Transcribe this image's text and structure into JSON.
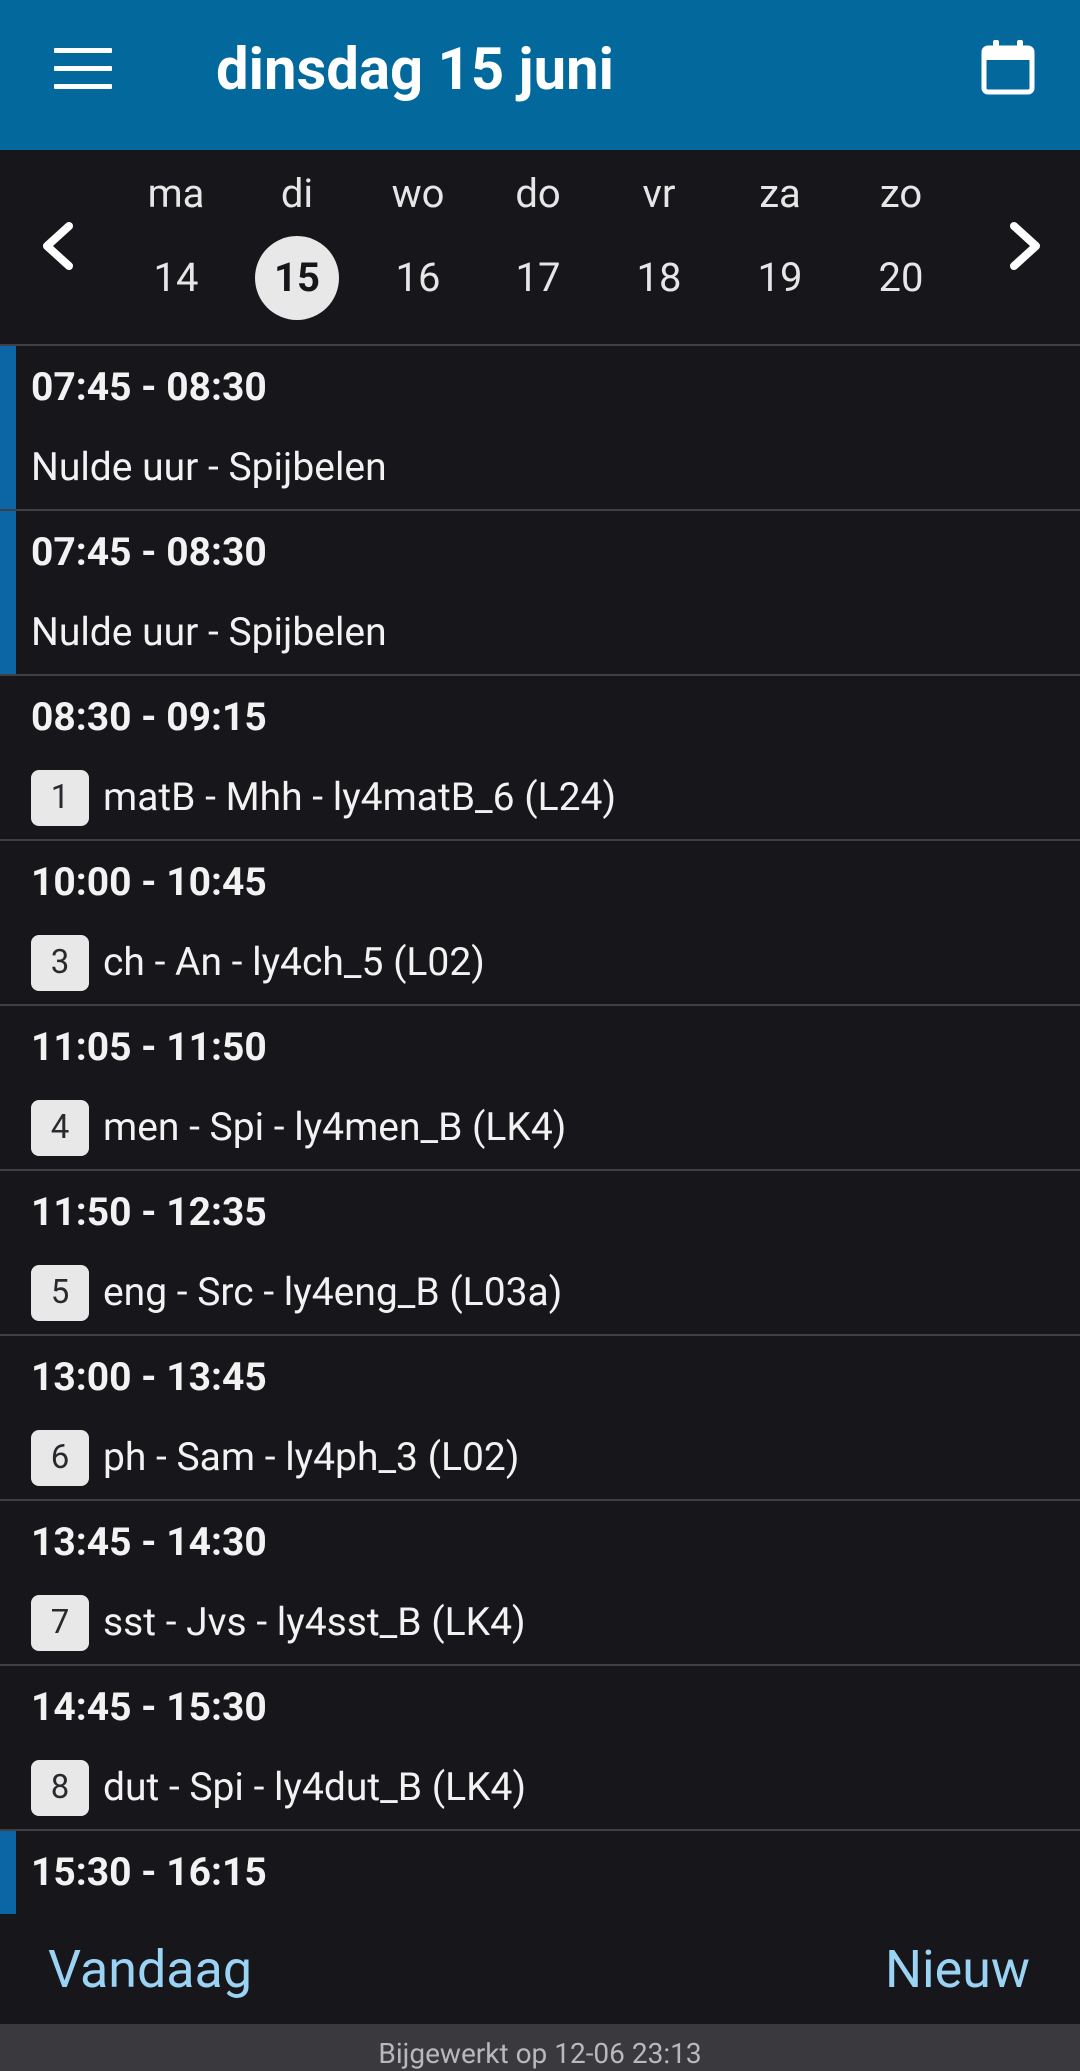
{
  "header": {
    "title": "dinsdag 15 juni",
    "menu_icon": "hamburger-menu-icon",
    "calendar_icon": "calendar-icon",
    "background": "#03689b"
  },
  "week": {
    "prev_icon": "chevron-left-icon",
    "next_icon": "chevron-right-icon",
    "days": [
      {
        "name": "ma",
        "num": "14"
      },
      {
        "name": "di",
        "num": "15"
      },
      {
        "name": "wo",
        "num": "16"
      },
      {
        "name": "do",
        "num": "17"
      },
      {
        "name": "vr",
        "num": "18"
      },
      {
        "name": "za",
        "num": "19"
      },
      {
        "name": "zo",
        "num": "20"
      }
    ],
    "selected": "15"
  },
  "appointments": [
    {
      "time": "07:45 - 08:30",
      "title": "Nulde uur - Spijbelen",
      "hour": "",
      "accent": true
    },
    {
      "time": "07:45 - 08:30",
      "title": "Nulde uur - Spijbelen",
      "hour": "",
      "accent": true
    },
    {
      "time": "08:30 - 09:15",
      "title": "matB - Mhh - ly4matB_6 (L24)",
      "hour": "1",
      "accent": false
    },
    {
      "time": "10:00 - 10:45",
      "title": "ch - An - ly4ch_5 (L02)",
      "hour": "3",
      "accent": false
    },
    {
      "time": "11:05 - 11:50",
      "title": "men - Spi - ly4men_B (LK4)",
      "hour": "4",
      "accent": false
    },
    {
      "time": "11:50 - 12:35",
      "title": "eng - Src - ly4eng_B (L03a)",
      "hour": "5",
      "accent": false
    },
    {
      "time": "13:00 - 13:45",
      "title": "ph - Sam - ly4ph_3 (L02)",
      "hour": "6",
      "accent": false
    },
    {
      "time": "13:45 - 14:30",
      "title": "sst - Jvs - ly4sst_B (LK4)",
      "hour": "7",
      "accent": false
    },
    {
      "time": "14:45 - 15:30",
      "title": "dut - Spi - ly4dut_B (LK4)",
      "hour": "8",
      "accent": false
    },
    {
      "time": "15:30 - 16:15",
      "title": "",
      "hour": "",
      "accent": true
    }
  ],
  "bottom": {
    "today_label": "Vandaag",
    "new_label": "Nieuw",
    "status": "Bijgewerkt op 12-06 23:13",
    "accent_color": "#9bd3f5"
  }
}
